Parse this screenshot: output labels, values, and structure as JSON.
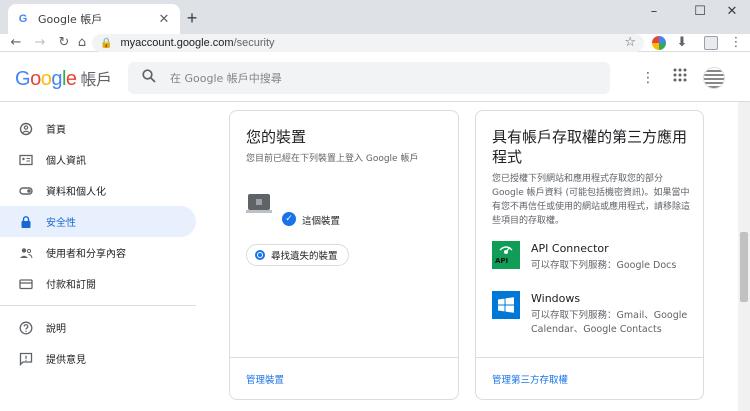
{
  "browser": {
    "tab_title": "Google 帳戶",
    "favicon_letter": "G",
    "url_host": "myaccount.google.com",
    "url_path": "/security",
    "new_tab": "+",
    "close": "✕"
  },
  "header": {
    "logo_letters": [
      "G",
      "o",
      "o",
      "g",
      "l",
      "e"
    ],
    "logo_colors": [
      "#4285f4",
      "#ea4335",
      "#fbbc05",
      "#4285f4",
      "#34a853",
      "#ea4335"
    ],
    "product": "帳戶",
    "search_placeholder": "在 Google 帳戶中搜尋"
  },
  "sidebar": {
    "items": [
      {
        "label": "首頁",
        "icon": "home-icon"
      },
      {
        "label": "個人資訊",
        "icon": "id-card-icon"
      },
      {
        "label": "資料和個人化",
        "icon": "toggle-icon"
      },
      {
        "label": "安全性",
        "icon": "lock-icon",
        "active": true
      },
      {
        "label": "使用者和分享內容",
        "icon": "people-icon"
      },
      {
        "label": "付款和訂閱",
        "icon": "credit-card-icon"
      }
    ],
    "secondary": [
      {
        "label": "說明",
        "icon": "help-icon"
      },
      {
        "label": "提供意見",
        "icon": "feedback-icon"
      }
    ]
  },
  "devices_card": {
    "title": "您的裝置",
    "desc": "您目前已經在下列裝置上登入 Google 帳戶",
    "device_label": "這個裝置",
    "find_button": "尋找遺失的裝置",
    "footer_link": "管理裝置"
  },
  "third_party_card": {
    "title": "具有帳戶存取權的第三方應用程式",
    "desc": "您已授權下列網站和應用程式存取您的部分 Google 帳戶資料 (可能包括機密資訊)。如果當中有您不再信任或使用的網站或應用程式，請移除這些項目的存取權。",
    "apps": [
      {
        "name": "API Connector",
        "access": "可以存取下列服務：Google Docs",
        "icon": "api-connector-icon",
        "icon_text": "API"
      },
      {
        "name": "Windows",
        "access": "可以存取下列服務：Gmail、Google Calendar、Google Contacts",
        "icon": "windows-icon"
      }
    ],
    "footer_link": "管理第三方存取權"
  }
}
